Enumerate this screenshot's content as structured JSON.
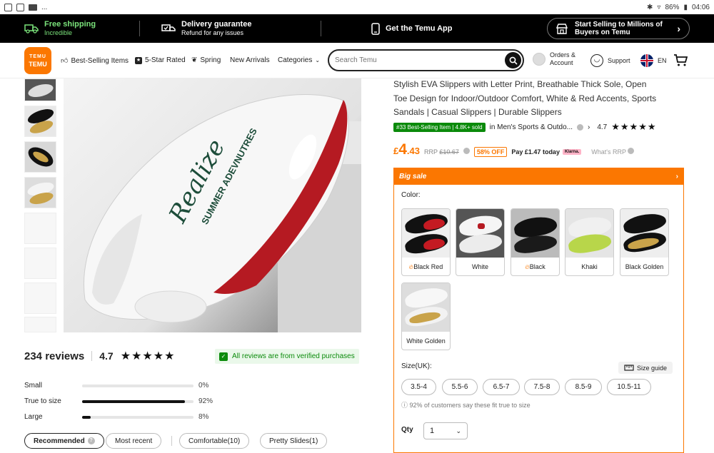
{
  "statusbar": {
    "dots": "...",
    "battery": "86%",
    "time": "04:06"
  },
  "promo": {
    "shipping_title": "Free shipping",
    "shipping_sub": "Incredible",
    "delivery_title": "Delivery guarantee",
    "delivery_sub": "Refund for any issues",
    "app_title": "Get the Temu App",
    "sell_line1": "Start Selling to Millions of",
    "sell_line2": "Buyers on Temu"
  },
  "nav": {
    "logo_line1": "TEMU",
    "logo_line2": "TEMU",
    "links": [
      "Best-Selling Items",
      "5-Star Rated",
      "Spring",
      "New Arrivals",
      "Categories"
    ],
    "search_placeholder": "Search Temu",
    "orders_line1": "Orders &",
    "orders_line2": "Account",
    "support": "Support",
    "lang": "EN"
  },
  "reviews": {
    "count": "234 reviews",
    "rating": "4.7",
    "stars": "★★★★★",
    "verified": "All reviews are from verified purchases",
    "fit": [
      {
        "label": "Small",
        "pct": "0%",
        "value": 0
      },
      {
        "label": "True to size",
        "pct": "92%",
        "value": 0.92
      },
      {
        "label": "Large",
        "pct": "8%",
        "value": 0.08
      }
    ],
    "tabs": [
      "Recommended",
      "Most recent",
      "Comfortable(10)",
      "Pretty Slides(1)"
    ]
  },
  "product": {
    "title": "Stylish EVA Slippers with Letter Print, Breathable Thick Sole, Open Toe Design for Indoor/Outdoor Comfort, White & Red Accents, Sports Sandals | Casual Slippers | Durable Slippers",
    "bestseller": "#33 Best-Selling Item | 4.8K+ sold",
    "category": "in Men's Sports & Outdo...",
    "rating": "4.7",
    "stars": "★★★★★",
    "price_currency": "£",
    "price_int": "4",
    "price_dec": ".43",
    "rrp_label": "RRP",
    "rrp_value": "£10.67",
    "off": "58% OFF",
    "pay": "Pay £1.47 today",
    "klarna": "Klarna.",
    "whats_rrp": "What's RRP"
  },
  "options": {
    "banner": "Big sale",
    "color_label": "Color:",
    "colors": [
      {
        "label": "Black Red",
        "hot": true
      },
      {
        "label": "White",
        "hot": false
      },
      {
        "label": "Black",
        "hot": true
      },
      {
        "label": "Khaki",
        "hot": false
      },
      {
        "label": "Black Golden",
        "hot": false
      },
      {
        "label": "White Golden",
        "hot": false
      }
    ],
    "size_label": "Size(UK):",
    "size_guide": "Size guide",
    "sizes": [
      "3.5-4",
      "5.5-6",
      "6.5-7",
      "7.5-8",
      "8.5-9",
      "10.5-11"
    ],
    "fit_note": "92% of customers say these fit true to size",
    "qty_label": "Qty",
    "qty_value": "1"
  },
  "image_text": {
    "brand": "Realize",
    "line2": "SUMMER ADEVNUTRES"
  }
}
